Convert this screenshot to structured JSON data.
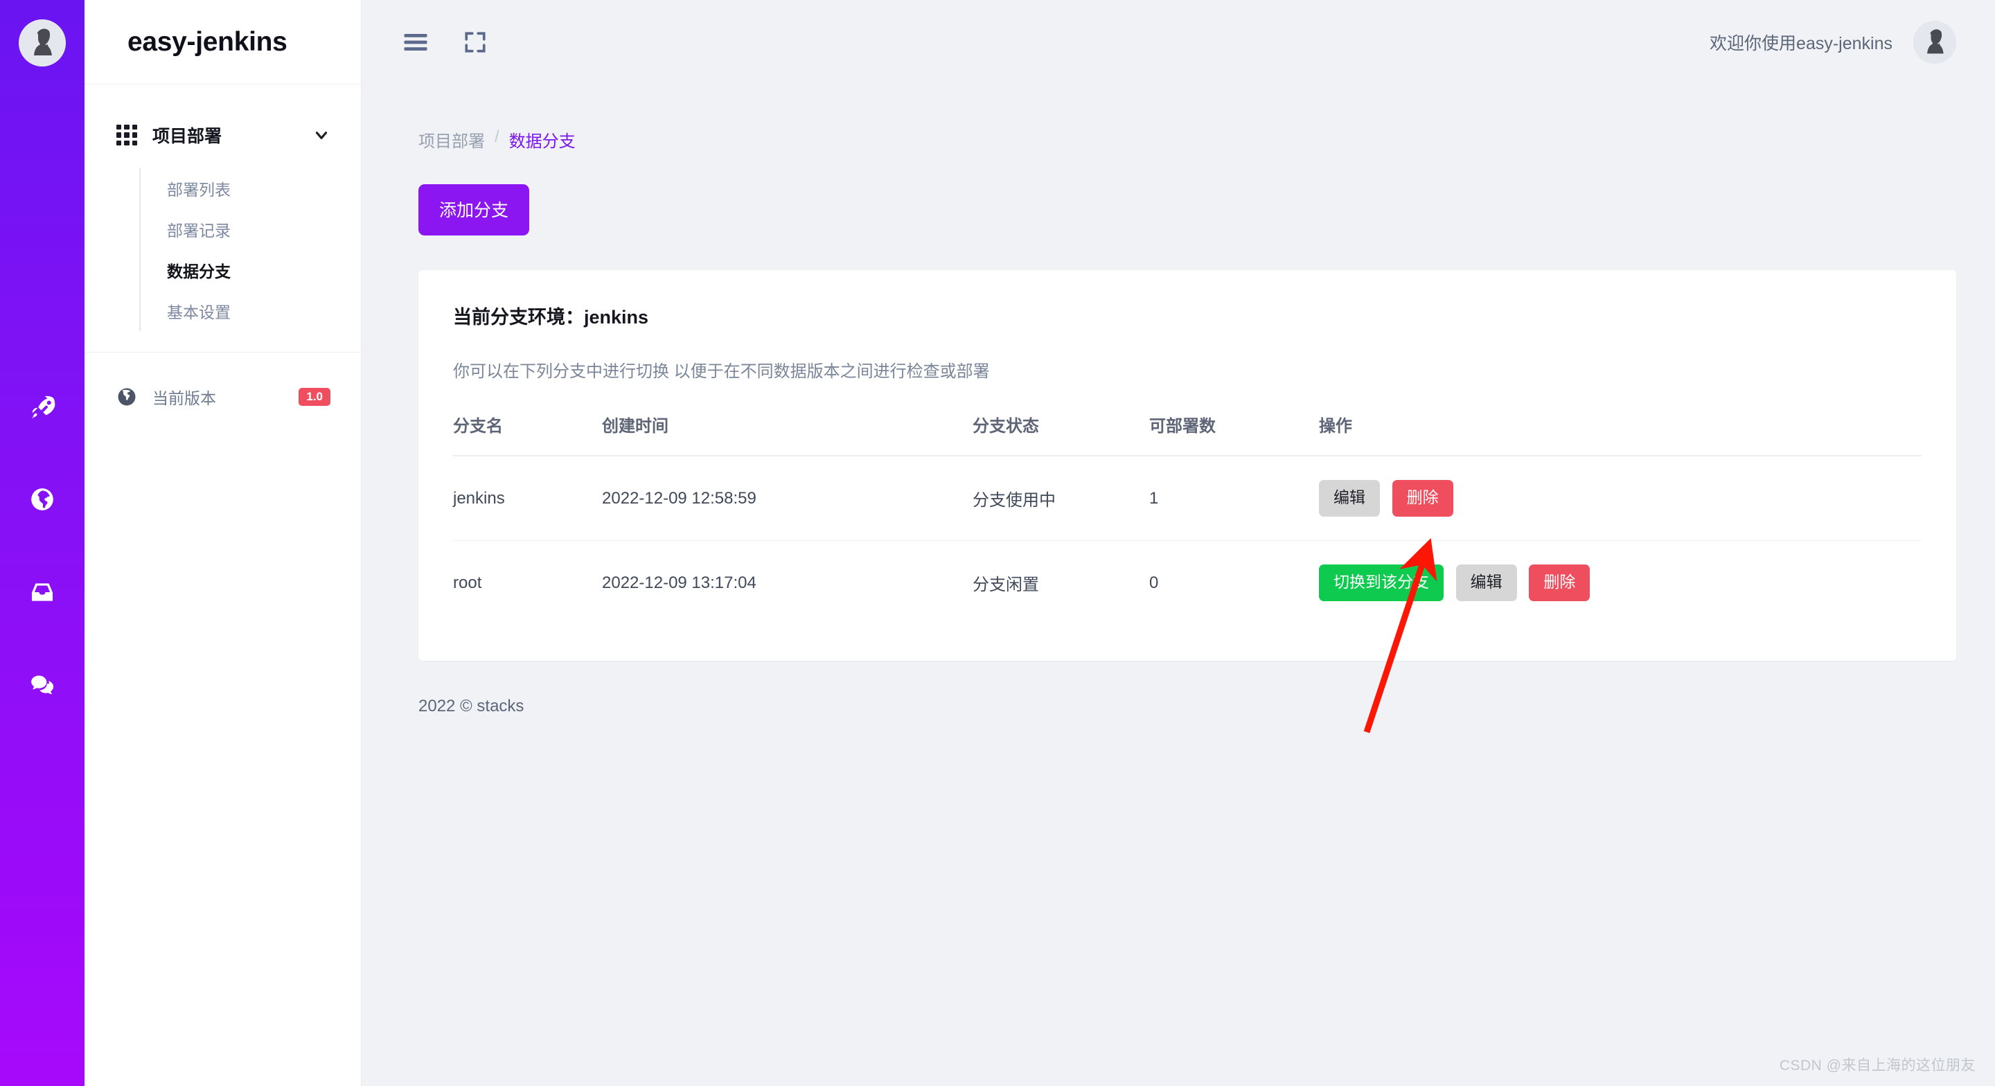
{
  "brand": {
    "title": "easy-jenkins"
  },
  "sidebar": {
    "group": {
      "title": "项目部署",
      "icon": "grid-icon",
      "chevron": "chevron-down-icon"
    },
    "items": [
      {
        "label": "部署列表",
        "active": false
      },
      {
        "label": "部署记录",
        "active": false
      },
      {
        "label": "数据分支",
        "active": true
      },
      {
        "label": "基本设置",
        "active": false
      }
    ],
    "version": {
      "label": "当前版本",
      "badge": "1.0",
      "icon": "globe-icon",
      "badge_color": "#ef4e5e"
    },
    "rail_icons": [
      "rocket-icon",
      "globe-icon",
      "inbox-icon",
      "chat-icon"
    ]
  },
  "topbar": {
    "menu_icon": "hamburger-icon",
    "fullscreen_icon": "fullscreen-icon",
    "welcome": "欢迎你使用easy-jenkins",
    "avatar": "user-avatar"
  },
  "breadcrumb": {
    "parent": "项目部署",
    "separator": "/",
    "current": "数据分支"
  },
  "toolbar": {
    "add_label": "添加分支",
    "add_color": "#8c16f2"
  },
  "card": {
    "title": "当前分支环境：jenkins",
    "description": "你可以在下列分支中进行切换 以便于在不同数据版本之间进行检查或部署"
  },
  "table": {
    "headers": [
      "分支名",
      "创建时间",
      "分支状态",
      "可部署数",
      "操作"
    ],
    "rows": [
      {
        "name": "jenkins",
        "created": "2022-12-09 12:58:59",
        "status": "分支使用中",
        "count": "1",
        "actions": [
          {
            "label": "编辑",
            "kind": "edit"
          },
          {
            "label": "删除",
            "kind": "delete"
          }
        ]
      },
      {
        "name": "root",
        "created": "2022-12-09 13:17:04",
        "status": "分支闲置",
        "count": "0",
        "actions": [
          {
            "label": "切换到该分支",
            "kind": "switch"
          },
          {
            "label": "编辑",
            "kind": "edit"
          },
          {
            "label": "删除",
            "kind": "delete"
          }
        ]
      }
    ]
  },
  "footer": {
    "text": "2022 © stacks"
  },
  "watermark": {
    "text": "CSDN @来自上海的这位朋友"
  },
  "colors": {
    "accent_purple": "#8c16f2",
    "rail_purple": "#7d12f5",
    "green": "#0ecb4f",
    "red": "#ef4e5e",
    "gray_btn": "#d6d6d6",
    "arrow_red": "#fb1606"
  },
  "annotation": {
    "arrow": "red-arrow-pointer"
  }
}
